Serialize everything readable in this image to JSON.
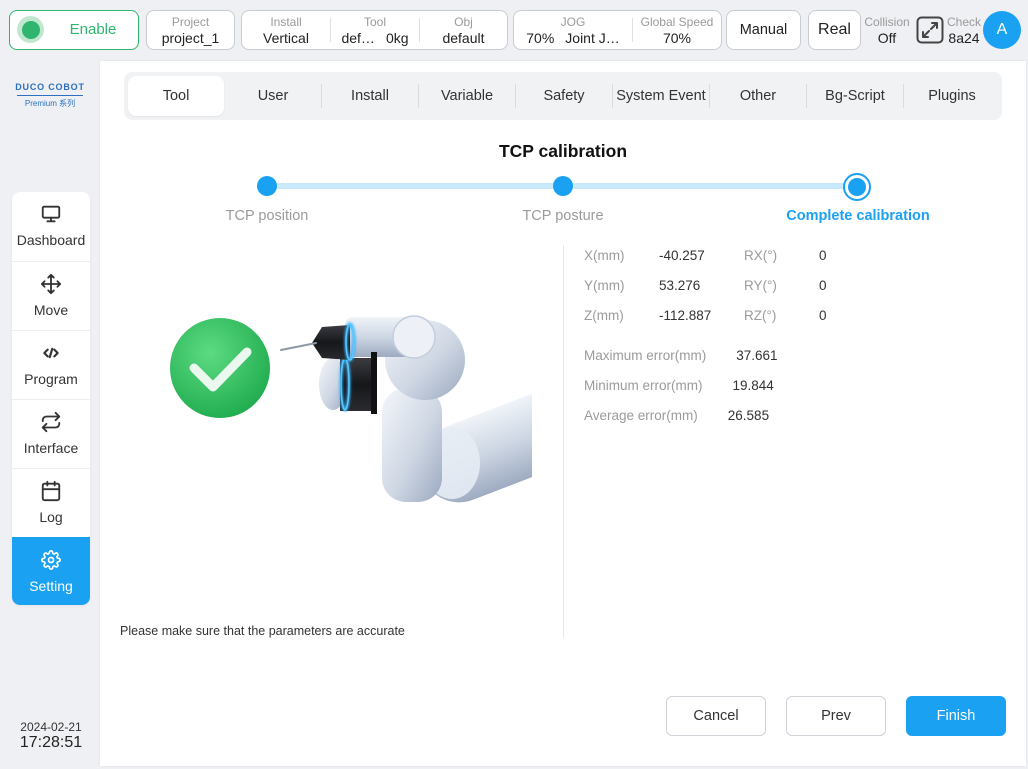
{
  "colors": {
    "accent": "#1ba1f2",
    "enable_green": "#2fb56e",
    "success_green": "#2fbf5c",
    "track": "#c8e9fb"
  },
  "topbar": {
    "enable": {
      "label": "Enable",
      "icon": "status-dot-icon"
    },
    "project": {
      "label": "Project",
      "value": "project_1"
    },
    "install": {
      "label": "Install",
      "value": "Vertical"
    },
    "tool": {
      "label": "Tool",
      "name": "def…",
      "weight": "0kg"
    },
    "obj": {
      "label": "Obj",
      "value": "default"
    },
    "jog": {
      "label": "JOG",
      "speed": "70%",
      "mode": "Joint J…"
    },
    "global_speed": {
      "label": "Global Speed",
      "value": "70%"
    },
    "mode_button": "Manual",
    "run_button": "Real",
    "collision": {
      "label": "Collision",
      "value": "Off"
    },
    "fullscreen_icon": "expand-icon",
    "check": {
      "label": "Check",
      "value": "8a24"
    },
    "avatar": "A"
  },
  "sidebar": {
    "logo": {
      "brand": "DUCO COBOT",
      "series": "Premium 系列"
    },
    "items": [
      {
        "label": "Dashboard",
        "icon": "monitor-icon",
        "active": false
      },
      {
        "label": "Move",
        "icon": "move-arrows-icon",
        "active": false
      },
      {
        "label": "Program",
        "icon": "code-icon",
        "active": false
      },
      {
        "label": "Interface",
        "icon": "swap-arrows-icon",
        "active": false
      },
      {
        "label": "Log",
        "icon": "calendar-icon",
        "active": false
      },
      {
        "label": "Setting",
        "icon": "gear-icon",
        "active": true
      }
    ],
    "date": "2024-02-21",
    "time": "17:28:51"
  },
  "tabs": [
    {
      "label": "Tool",
      "active": true
    },
    {
      "label": "User",
      "active": false
    },
    {
      "label": "Install",
      "active": false
    },
    {
      "label": "Variable",
      "active": false
    },
    {
      "label": "Safety",
      "active": false
    },
    {
      "label": "System Event",
      "active": false
    },
    {
      "label": "Other",
      "active": false
    },
    {
      "label": "Bg-Script",
      "active": false
    },
    {
      "label": "Plugins",
      "active": false
    }
  ],
  "calibration": {
    "title": "TCP calibration",
    "steps": [
      {
        "label": "TCP position",
        "state": "done"
      },
      {
        "label": "TCP posture",
        "state": "done"
      },
      {
        "label": "Complete calibration",
        "state": "current"
      }
    ],
    "badge_icon": "check-circle-icon",
    "image_icon": "robot-arm-icon",
    "result": {
      "pose": [
        {
          "axis": "X(mm)",
          "value": "-40.257",
          "rot_axis": "RX(°)",
          "rot_value": "0"
        },
        {
          "axis": "Y(mm)",
          "value": "53.276",
          "rot_axis": "RY(°)",
          "rot_value": "0"
        },
        {
          "axis": "Z(mm)",
          "value": "-112.887",
          "rot_axis": "RZ(°)",
          "rot_value": "0"
        }
      ],
      "errors": [
        {
          "label": "Maximum error(mm)",
          "value": "37.661"
        },
        {
          "label": "Minimum error(mm)",
          "value": "19.844"
        },
        {
          "label": "Average error(mm)",
          "value": "26.585"
        }
      ]
    },
    "note": "Please make sure that the parameters are accurate",
    "buttons": {
      "cancel": "Cancel",
      "prev": "Prev",
      "finish": "Finish"
    }
  }
}
